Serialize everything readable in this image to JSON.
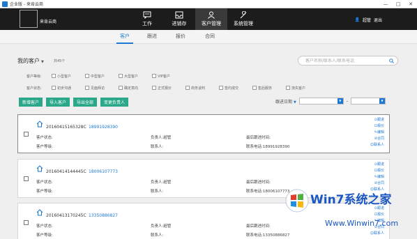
{
  "window": {
    "title": "企业版 - 来肯云商",
    "controls": [
      "—",
      "□",
      "✕"
    ]
  },
  "header": {
    "brand": "来肯云商",
    "nav": [
      {
        "label": "工作",
        "icon": "chat-icon"
      },
      {
        "label": "进销存",
        "icon": "tray-icon"
      },
      {
        "label": "客户管理",
        "icon": "person-icon",
        "active": true
      },
      {
        "label": "系统管理",
        "icon": "wrench-icon"
      }
    ],
    "user": "超管",
    "logout": "退出"
  },
  "subtabs": [
    "客户",
    "跟进",
    "报价",
    "合同"
  ],
  "toolbar": {
    "title": "我的客户",
    "total": "共45个",
    "search_placeholder": "客户名称/联系人/联系电话"
  },
  "filters": {
    "level_label": "客户等级:",
    "levels": [
      "小型客户",
      "中型客户",
      "大型客户",
      "VIP客户"
    ],
    "status_label": "客户状态:",
    "statuses": [
      "初步沟通",
      "见面拜访",
      "确定意向",
      "正式报价",
      "商务谈判",
      "签约成交",
      "售后服务",
      "流失客户"
    ]
  },
  "buttons": [
    "新增客户",
    "导入客户",
    "导出全部",
    "变更负责人"
  ],
  "sort": {
    "label": "跟进日期"
  },
  "card_labels": {
    "status": "客户状态:",
    "level": "客户等级:",
    "owner": "负责人:",
    "contact": "联系人:",
    "last_follow": "最后跟进时间:",
    "phone": "联系电话:"
  },
  "card_actions": [
    "跟进",
    "报价",
    "编辑",
    "合同",
    "联系人"
  ],
  "customers": [
    {
      "id": "20160415165328C",
      "phone": "18991928390",
      "owner": "超管",
      "contact_phone": "18991928390"
    },
    {
      "id": "20160414144445C",
      "phone": "18006107773",
      "owner": "超管",
      "contact_phone": "18006107773"
    },
    {
      "id": "20160413170245C",
      "phone": "13350886827",
      "owner": "超管",
      "contact_phone": "13350886827"
    }
  ],
  "watermark": {
    "line1": "Win7系统之家",
    "line2": "Www.Winwin7.com"
  },
  "colors": {
    "accent": "#1e78d2",
    "button": "#2aa889",
    "header": "#1c1c1c"
  }
}
